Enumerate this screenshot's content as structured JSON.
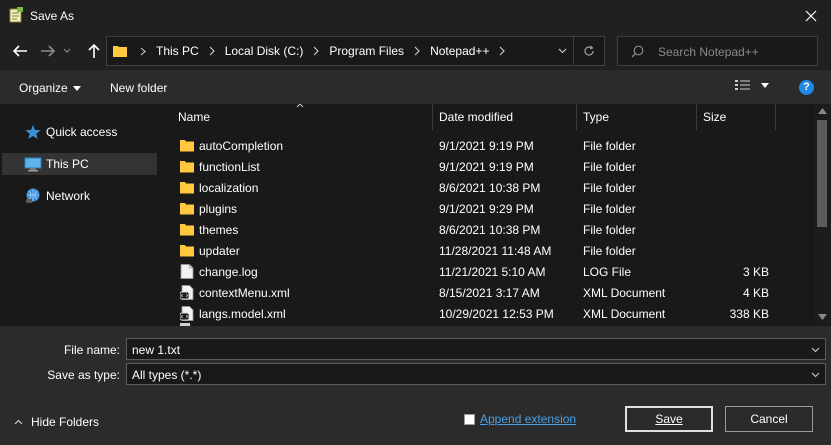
{
  "window": {
    "title": "Save As"
  },
  "address": {
    "crumbs": [
      "This PC",
      "Local Disk (C:)",
      "Program Files",
      "Notepad++"
    ]
  },
  "search": {
    "placeholder": "Search Notepad++"
  },
  "toolbar": {
    "organize_label": "Organize",
    "new_folder_label": "New folder"
  },
  "nav": {
    "items": [
      {
        "label": "Quick access",
        "icon": "star-icon"
      },
      {
        "label": "This PC",
        "icon": "computer-icon",
        "selected": true
      },
      {
        "label": "Network",
        "icon": "network-icon"
      }
    ]
  },
  "columns": {
    "name": "Name",
    "date": "Date modified",
    "type": "Type",
    "size": "Size"
  },
  "files": [
    {
      "name": "autoCompletion",
      "date": "9/1/2021 9:19 PM",
      "type": "File folder",
      "size": "",
      "icon": "folder-icon"
    },
    {
      "name": "functionList",
      "date": "9/1/2021 9:19 PM",
      "type": "File folder",
      "size": "",
      "icon": "folder-icon"
    },
    {
      "name": "localization",
      "date": "8/6/2021 10:38 PM",
      "type": "File folder",
      "size": "",
      "icon": "folder-icon"
    },
    {
      "name": "plugins",
      "date": "9/1/2021 9:29 PM",
      "type": "File folder",
      "size": "",
      "icon": "folder-icon"
    },
    {
      "name": "themes",
      "date": "8/6/2021 10:38 PM",
      "type": "File folder",
      "size": "",
      "icon": "folder-icon"
    },
    {
      "name": "updater",
      "date": "11/28/2021 11:48 AM",
      "type": "File folder",
      "size": "",
      "icon": "folder-icon"
    },
    {
      "name": "change.log",
      "date": "11/21/2021 5:10 AM",
      "type": "LOG File",
      "size": "3 KB",
      "icon": "text-file-icon"
    },
    {
      "name": "contextMenu.xml",
      "date": "8/15/2021 3:17 AM",
      "type": "XML Document",
      "size": "4 KB",
      "icon": "xml-file-icon"
    },
    {
      "name": "langs.model.xml",
      "date": "10/29/2021 12:53 PM",
      "type": "XML Document",
      "size": "338 KB",
      "icon": "xml-file-icon"
    }
  ],
  "form": {
    "file_name_label": "File name:",
    "file_name_value": "new 1.txt",
    "save_type_label": "Save as type:",
    "save_type_value": "All types (*.*)"
  },
  "footer": {
    "hide_folders_label": "Hide Folders",
    "append_extension_label": "Append extension",
    "save_label": "Save",
    "cancel_label": "Cancel"
  },
  "colors": {
    "folder": "#ffc83d",
    "accent": "#1e8ae6",
    "link": "#4aa0e6"
  }
}
